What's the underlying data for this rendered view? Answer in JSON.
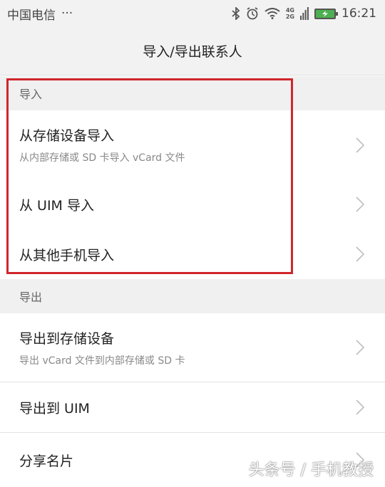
{
  "status_bar": {
    "carrier": "中国电信",
    "dots": "···",
    "network_top": "4G",
    "network_bottom": "2G",
    "time": "16:21",
    "icons": [
      "bluetooth-icon",
      "alarm-icon",
      "wifi-icon",
      "signal-icon",
      "battery-icon"
    ]
  },
  "header": {
    "title": "导入/导出联系人"
  },
  "import_section": {
    "header": "导入",
    "items": [
      {
        "title": "从存储设备导入",
        "subtitle": "从内部存储或 SD 卡导入 vCard 文件"
      },
      {
        "title": "从 UIM 导入"
      },
      {
        "title": "从其他手机导入"
      }
    ]
  },
  "export_section": {
    "header": "导出",
    "items": [
      {
        "title": "导出到存储设备",
        "subtitle": "导出 vCard 文件到内部存储或 SD 卡"
      },
      {
        "title": "导出到 UIM"
      },
      {
        "title": "分享名片"
      }
    ]
  },
  "watermark": "头条号 / 手机教授",
  "colors": {
    "highlight": "#d0262c",
    "battery": "#4caf50"
  }
}
